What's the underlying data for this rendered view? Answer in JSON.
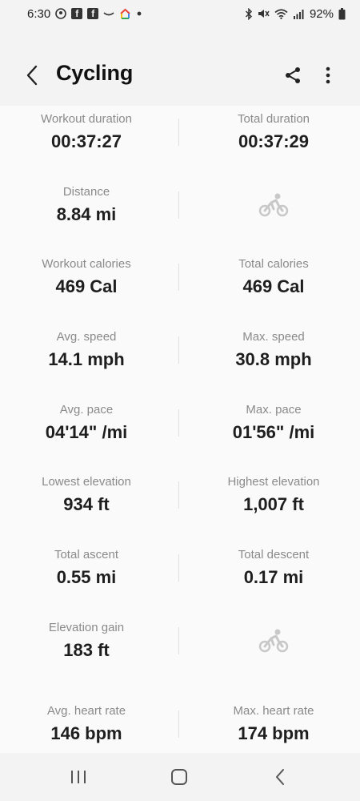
{
  "status_bar": {
    "time": "6:30",
    "battery": "92%"
  },
  "header": {
    "title": "Cycling"
  },
  "metrics": [
    {
      "label": "Workout duration",
      "value": "00:37:27"
    },
    {
      "label": "Total duration",
      "value": "00:37:29"
    },
    {
      "label": "Distance",
      "value": "8.84 mi"
    },
    {
      "label": "Workout calories",
      "value": "469 Cal"
    },
    {
      "label": "Total calories",
      "value": "469 Cal"
    },
    {
      "label": "Avg. speed",
      "value": "14.1 mph"
    },
    {
      "label": "Max. speed",
      "value": "30.8 mph"
    },
    {
      "label": "Avg. pace",
      "value": "04'14\" /mi"
    },
    {
      "label": "Max. pace",
      "value": "01'56\" /mi"
    },
    {
      "label": "Lowest elevation",
      "value": "934 ft"
    },
    {
      "label": "Highest elevation",
      "value": "1,007 ft"
    },
    {
      "label": "Total ascent",
      "value": "0.55 mi"
    },
    {
      "label": "Total descent",
      "value": "0.17 mi"
    },
    {
      "label": "Elevation gain",
      "value": "183 ft"
    },
    {
      "label": "Avg. heart rate",
      "value": "146 bpm"
    },
    {
      "label": "Max. heart rate",
      "value": "174 bpm"
    }
  ],
  "icons": {
    "status_left": [
      "location-icon",
      "facebook-icon",
      "facebook-icon",
      "amazon-icon",
      "google-home-icon",
      "dot-icon"
    ],
    "status_right": [
      "bluetooth-icon",
      "mute-icon",
      "wifi-icon",
      "signal-icon",
      "battery-icon"
    ],
    "placeholder": "cycling-icon",
    "nav": [
      "recent-apps-icon",
      "home-icon",
      "back-icon"
    ]
  }
}
